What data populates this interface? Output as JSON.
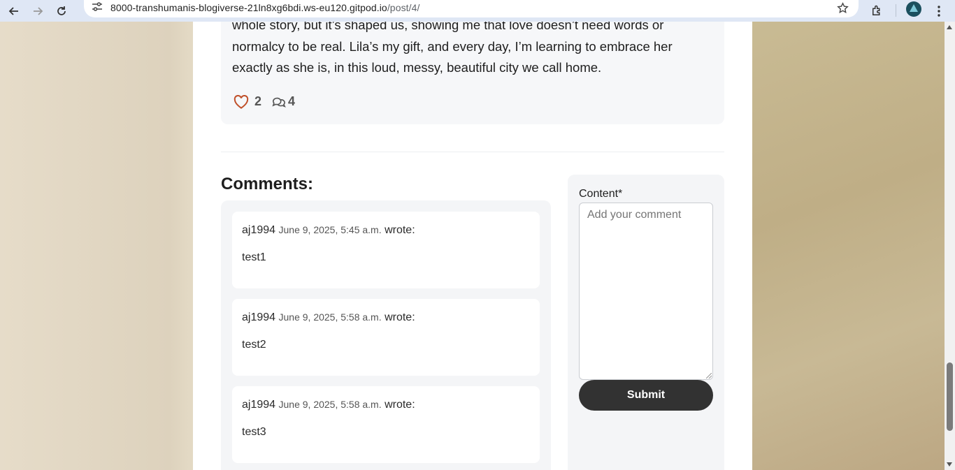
{
  "browser": {
    "url_host": "8000-transhumanis-blogiverse-21ln8xg6bdi.ws-eu120.gitpod.io",
    "url_path": "/post/4/"
  },
  "post": {
    "text_lines": [
      "whole story, but it’s shaped us, showing me that love doesn’t need words or",
      "normalcy to be real. Lila’s my gift, and every day, I’m learning to embrace her",
      "exactly as she is, in this loud, messy, beautiful city we call home."
    ],
    "likes": "2",
    "comments_count": "4"
  },
  "comments_section": {
    "title": "Comments:",
    "comments": [
      {
        "author": "aj1994",
        "date": "June 9, 2025, 5:45 a.m.",
        "wrote": "wrote:",
        "body": "test1"
      },
      {
        "author": "aj1994",
        "date": "June 9, 2025, 5:58 a.m.",
        "wrote": "wrote:",
        "body": "test2"
      },
      {
        "author": "aj1994",
        "date": "June 9, 2025, 5:58 a.m.",
        "wrote": "wrote:",
        "body": "test3"
      }
    ]
  },
  "form": {
    "label": "Content*",
    "placeholder": "Add your comment",
    "submit_label": "Submit"
  },
  "colors": {
    "heart": "#c0502a",
    "submit_bg": "#323232"
  }
}
